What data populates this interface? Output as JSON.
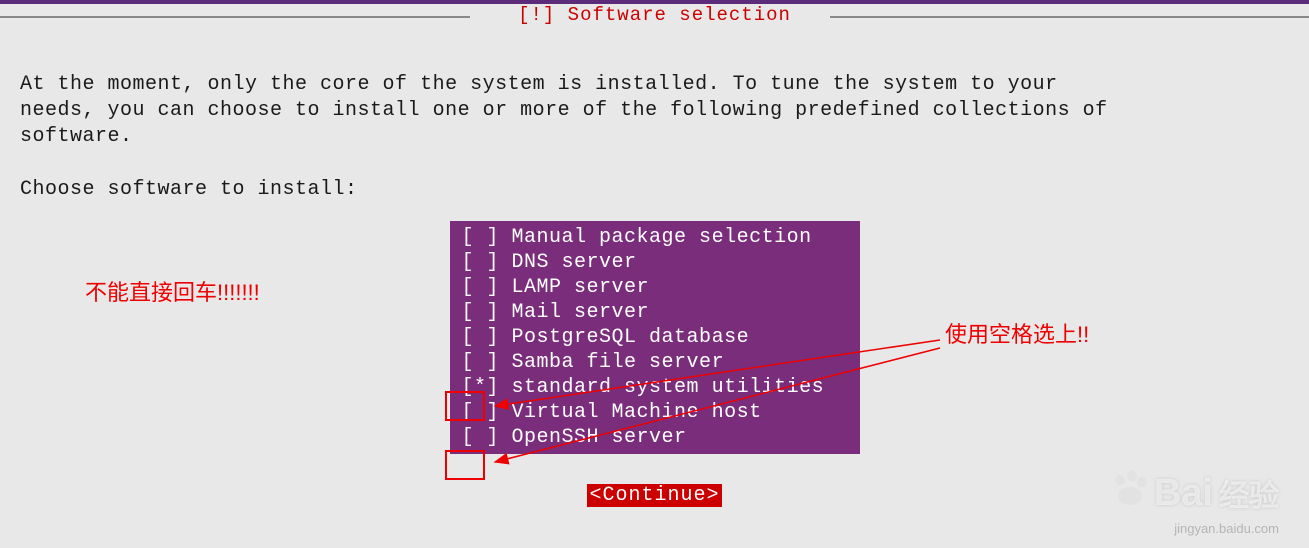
{
  "header": {
    "title": "[!] Software selection"
  },
  "description": "At the moment, only the core of the system is installed. To tune the system to your\nneeds, you can choose to install one or more of the following predefined collections of\nsoftware.",
  "prompt": "Choose software to install:",
  "options": [
    {
      "checked": false,
      "label": "Manual package selection"
    },
    {
      "checked": false,
      "label": "DNS server"
    },
    {
      "checked": false,
      "label": "LAMP server"
    },
    {
      "checked": false,
      "label": "Mail server"
    },
    {
      "checked": false,
      "label": "PostgreSQL database"
    },
    {
      "checked": false,
      "label": "Samba file server"
    },
    {
      "checked": true,
      "label": "standard system utilities"
    },
    {
      "checked": false,
      "label": "Virtual Machine host"
    },
    {
      "checked": false,
      "label": "OpenSSH server"
    }
  ],
  "continue_label": "<Continue>",
  "annotations": {
    "left": "不能直接回车!!!!!!!",
    "right": "使用空格选上!!"
  },
  "watermark": {
    "brand": "Bai",
    "brand_suffix": "经验",
    "sub": "jingyan.baidu.com"
  },
  "colors": {
    "title_red": "#cc0000",
    "panel_purple": "#7a2d7a",
    "annotation_red": "#ee0000",
    "top_bar": "#5c2b7a"
  }
}
